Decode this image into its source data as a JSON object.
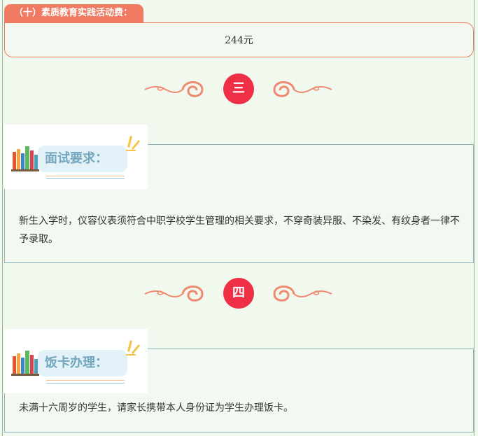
{
  "fee": {
    "tab_label": "（十）素质教育实践活动费：",
    "amount": "244元"
  },
  "sections": [
    {
      "number": "三",
      "title": "面试要求：",
      "text": "新生入学时，仪容仪表须符合中职学校学生管理的相关要求，不穿奇装异服、不染发、有纹身者一律不予录取。"
    },
    {
      "number": "四",
      "title": "饭卡办理：",
      "text": "未满十六周岁的学生，请家长携带本人身份证为学生办理饭卡。"
    }
  ],
  "colors": {
    "accent": "#f07b62",
    "number_circle": "#ef2f46",
    "title_text": "#74a6bd",
    "background": "#f1f8ee"
  },
  "icons": [
    "swirl-ornament-icon",
    "books-icon",
    "sparkle-icon"
  ]
}
